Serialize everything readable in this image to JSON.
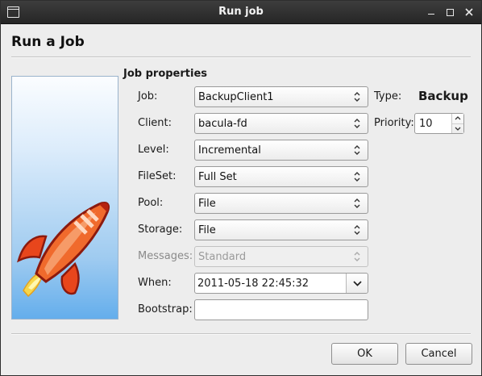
{
  "window": {
    "title": "Run job",
    "controls": [
      "minimize-icon",
      "maximize-icon",
      "close-icon"
    ]
  },
  "heading": "Run a Job",
  "group_title": "Job properties",
  "fields": {
    "job": {
      "label": "Job:",
      "value": "BackupClient1"
    },
    "client": {
      "label": "Client:",
      "value": "bacula-fd"
    },
    "level": {
      "label": "Level:",
      "value": "Incremental"
    },
    "fileset": {
      "label": "FileSet:",
      "value": "Full Set"
    },
    "pool": {
      "label": "Pool:",
      "value": "File"
    },
    "storage": {
      "label": "Storage:",
      "value": "File"
    },
    "messages": {
      "label": "Messages:",
      "value": "Standard",
      "disabled": true
    },
    "when": {
      "label": "When:",
      "value": "2011-05-18 22:45:32"
    },
    "bootstrap": {
      "label": "Bootstrap:",
      "value": ""
    }
  },
  "type": {
    "label": "Type:",
    "value": "Backup"
  },
  "priority": {
    "label": "Priority:",
    "value": "10"
  },
  "buttons": {
    "ok": "OK",
    "cancel": "Cancel"
  },
  "image": {
    "icon": "rocket-icon"
  }
}
